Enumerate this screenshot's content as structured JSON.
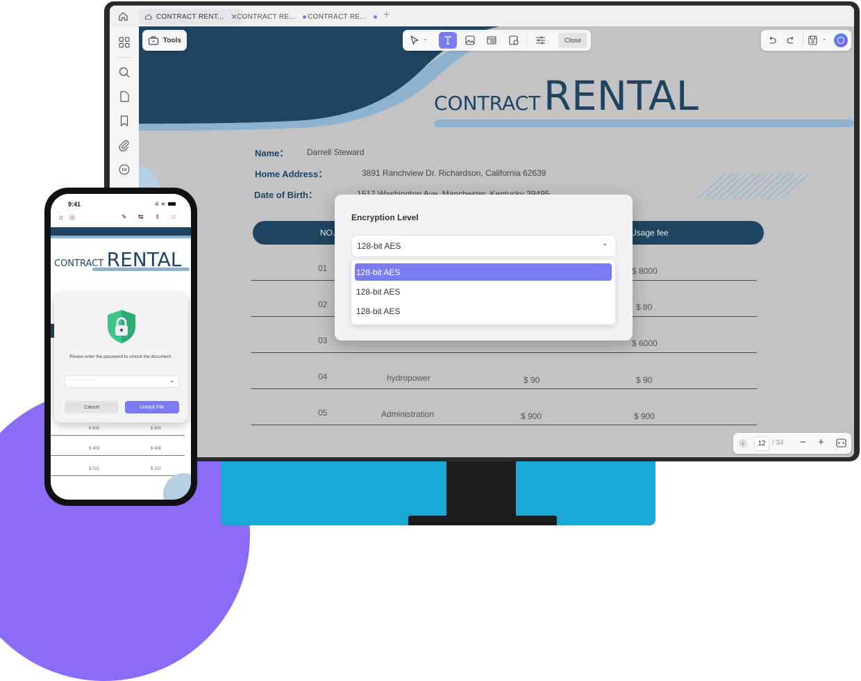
{
  "app": {
    "tabs": [
      {
        "label": "CONTRACT RENT...",
        "active": true
      },
      {
        "label": "CONTRACT RE...",
        "active": false
      },
      {
        "label": "CONTRACT RE...",
        "active": false
      }
    ],
    "tools_label": "Tools",
    "close_label": "Close",
    "page_current": "12",
    "page_total": "/ 34"
  },
  "document": {
    "title_small": "CONTRACT",
    "title_big": "RENTAL",
    "name_label": "Name：",
    "name_value": "Darrell Steward",
    "address_label": "Home Address：",
    "address_value": "3891 Ranchview Dr. Richardson, California 62639",
    "dob_label": "Date of Birth：",
    "dob_value": "1517 Washington Ave. Manchester, Kentucky 39495",
    "header_no": "NO.",
    "header_fee": "Usage fee",
    "rows": [
      {
        "no": "01",
        "item": "",
        "price": "",
        "fee": "$ 8000"
      },
      {
        "no": "02",
        "item": "",
        "price": "",
        "fee": "$ 80"
      },
      {
        "no": "03",
        "item": "",
        "price": "",
        "fee": "$ 6000"
      },
      {
        "no": "04",
        "item": "hydropower",
        "price": "$ 90",
        "fee": "$ 90"
      },
      {
        "no": "05",
        "item": "Administration",
        "price": "$ 900",
        "fee": "$ 900"
      }
    ]
  },
  "modal": {
    "title": "Encryption Level",
    "selected": "128-bit AES",
    "options": [
      "128-bit AES",
      "128-bit AES",
      "128-bit AES"
    ]
  },
  "phone": {
    "time": "9:41",
    "title_small": "CONTRACT",
    "title_big": "RENTAL",
    "message": "Please enter the password to unlock the document.",
    "password_placeholder": "••••••••••••",
    "cancel_label": "Cancel",
    "unlock_label": "Unlock File",
    "rows": [
      {
        "a": "$ 900",
        "b": "$ 900"
      },
      {
        "a": "$ 409",
        "b": "$ 409"
      },
      {
        "a": "$ 222",
        "b": "$ 222"
      }
    ]
  },
  "colors": {
    "accent": "#7b7cf4",
    "navy": "#1e4460",
    "light_blue": "#8fb3cf",
    "shield_green": "#3cc48a"
  }
}
